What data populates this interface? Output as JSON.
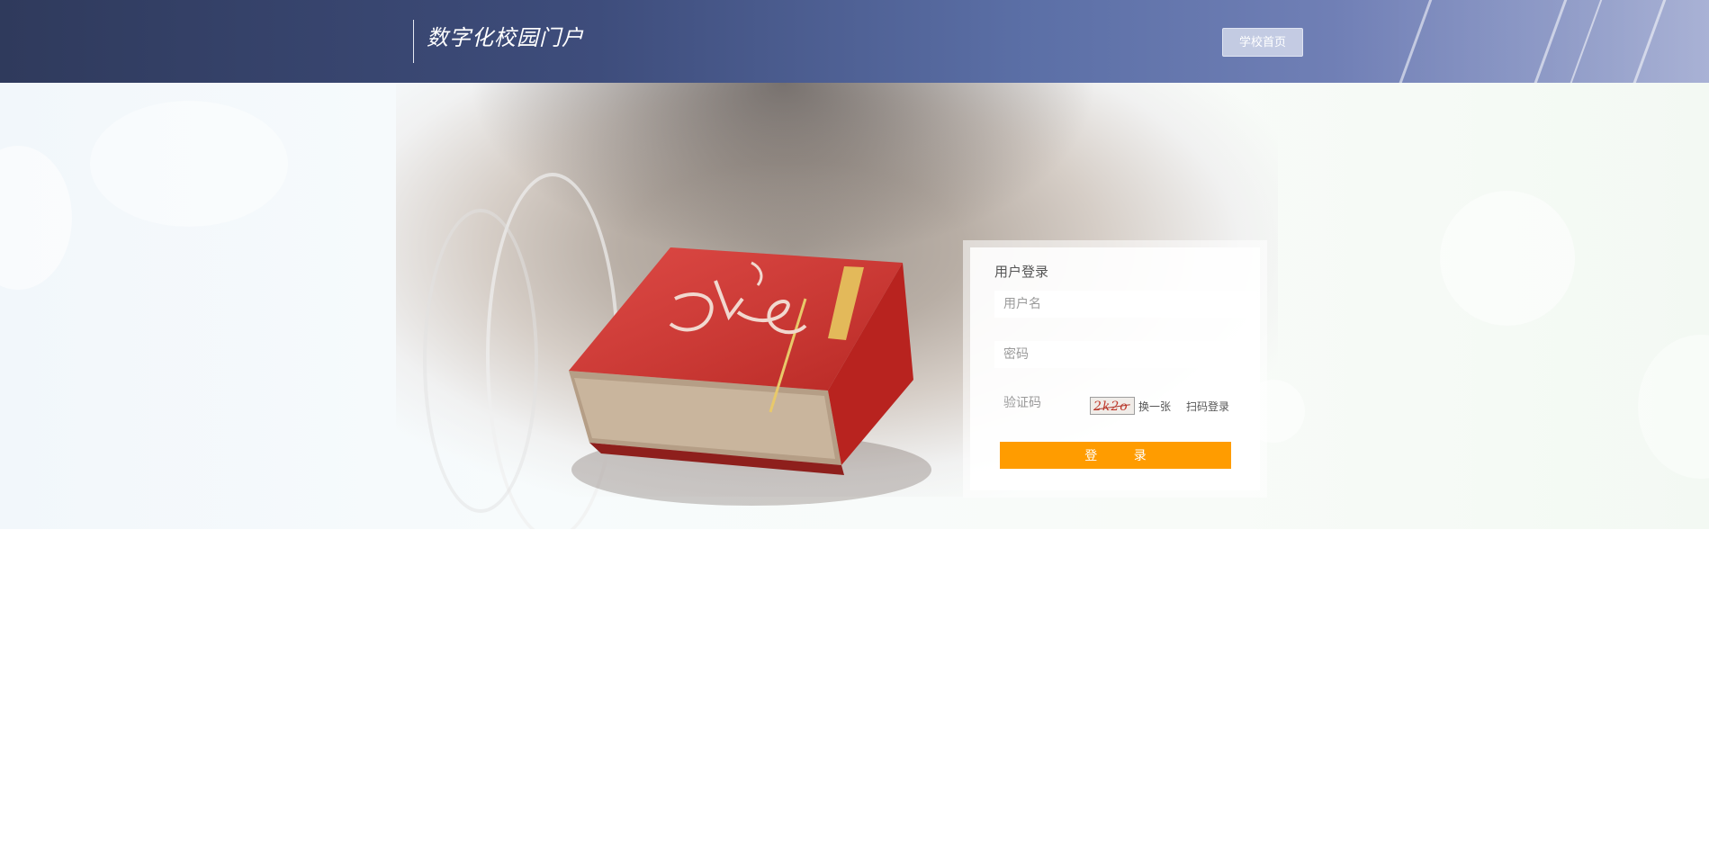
{
  "header": {
    "title": "数字化校园门户",
    "home_button": "学校首页"
  },
  "login": {
    "title": "用户登录",
    "username_placeholder": "用户名",
    "password_placeholder": "密码",
    "captcha_placeholder": "验证码",
    "captcha_image_text": "2k2o",
    "refresh_captcha": "换一张",
    "scan_login": "扫码登录",
    "submit": "登 录"
  },
  "colors": {
    "header_start": "#2f3a5c",
    "header_end": "#8c98c7",
    "accent": "#ff9c00"
  }
}
